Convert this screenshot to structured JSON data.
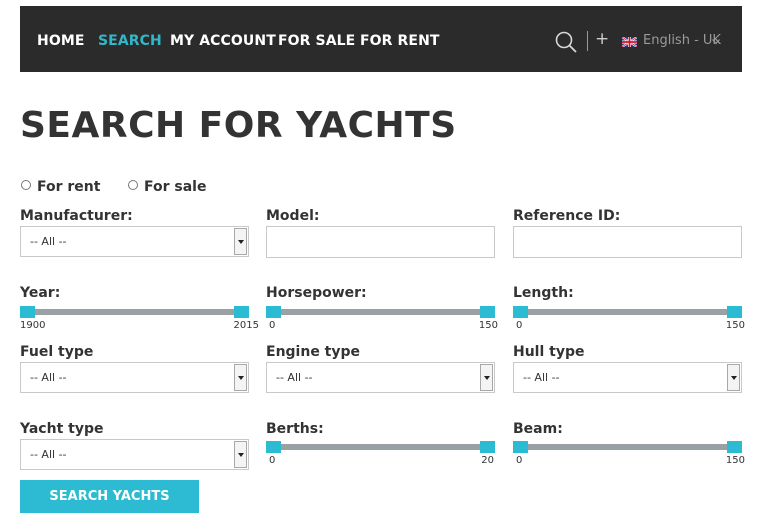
{
  "nav": {
    "items": [
      {
        "label": "HOME"
      },
      {
        "label": "SEARCH",
        "active": true
      },
      {
        "label": "MY ACCOUNT"
      },
      {
        "label": "FOR SALE"
      },
      {
        "label": "FOR RENT"
      }
    ],
    "search_icon": "search-icon",
    "plus_icon": "plus-icon",
    "language": "English - UK",
    "flag_icon": "uk-flag-icon"
  },
  "page": {
    "title": "SEARCH FOR YACHTS"
  },
  "radios": [
    {
      "label": "For rent",
      "checked": false
    },
    {
      "label": "For sale",
      "checked": false
    }
  ],
  "fields": {
    "manufacturer": {
      "label": "Manufacturer:",
      "value": "-- All --"
    },
    "model": {
      "label": "Model:",
      "value": ""
    },
    "reference_id": {
      "label": "Reference ID:",
      "value": ""
    },
    "year": {
      "label": "Year:",
      "min": "1900",
      "max": "2015"
    },
    "horsepower": {
      "label": "Horsepower:",
      "min": "0",
      "max": "150"
    },
    "length": {
      "label": "Length:",
      "min": "0",
      "max": "150"
    },
    "fuel_type": {
      "label": "Fuel type",
      "value": "-- All --"
    },
    "engine_type": {
      "label": "Engine type",
      "value": "-- All --"
    },
    "hull_type": {
      "label": "Hull type",
      "value": "-- All --"
    },
    "yacht_type": {
      "label": "Yacht type",
      "value": "-- All --"
    },
    "berths": {
      "label": "Berths:",
      "min": "0",
      "max": "20"
    },
    "beam": {
      "label": "Beam:",
      "min": "0",
      "max": "150"
    }
  },
  "search_button": {
    "label": "SEARCH YACHTS"
  },
  "colors": {
    "accent": "#2cbbd3",
    "nav_bg": "#2b2b2b",
    "slider_track": "#9aa1a5"
  }
}
